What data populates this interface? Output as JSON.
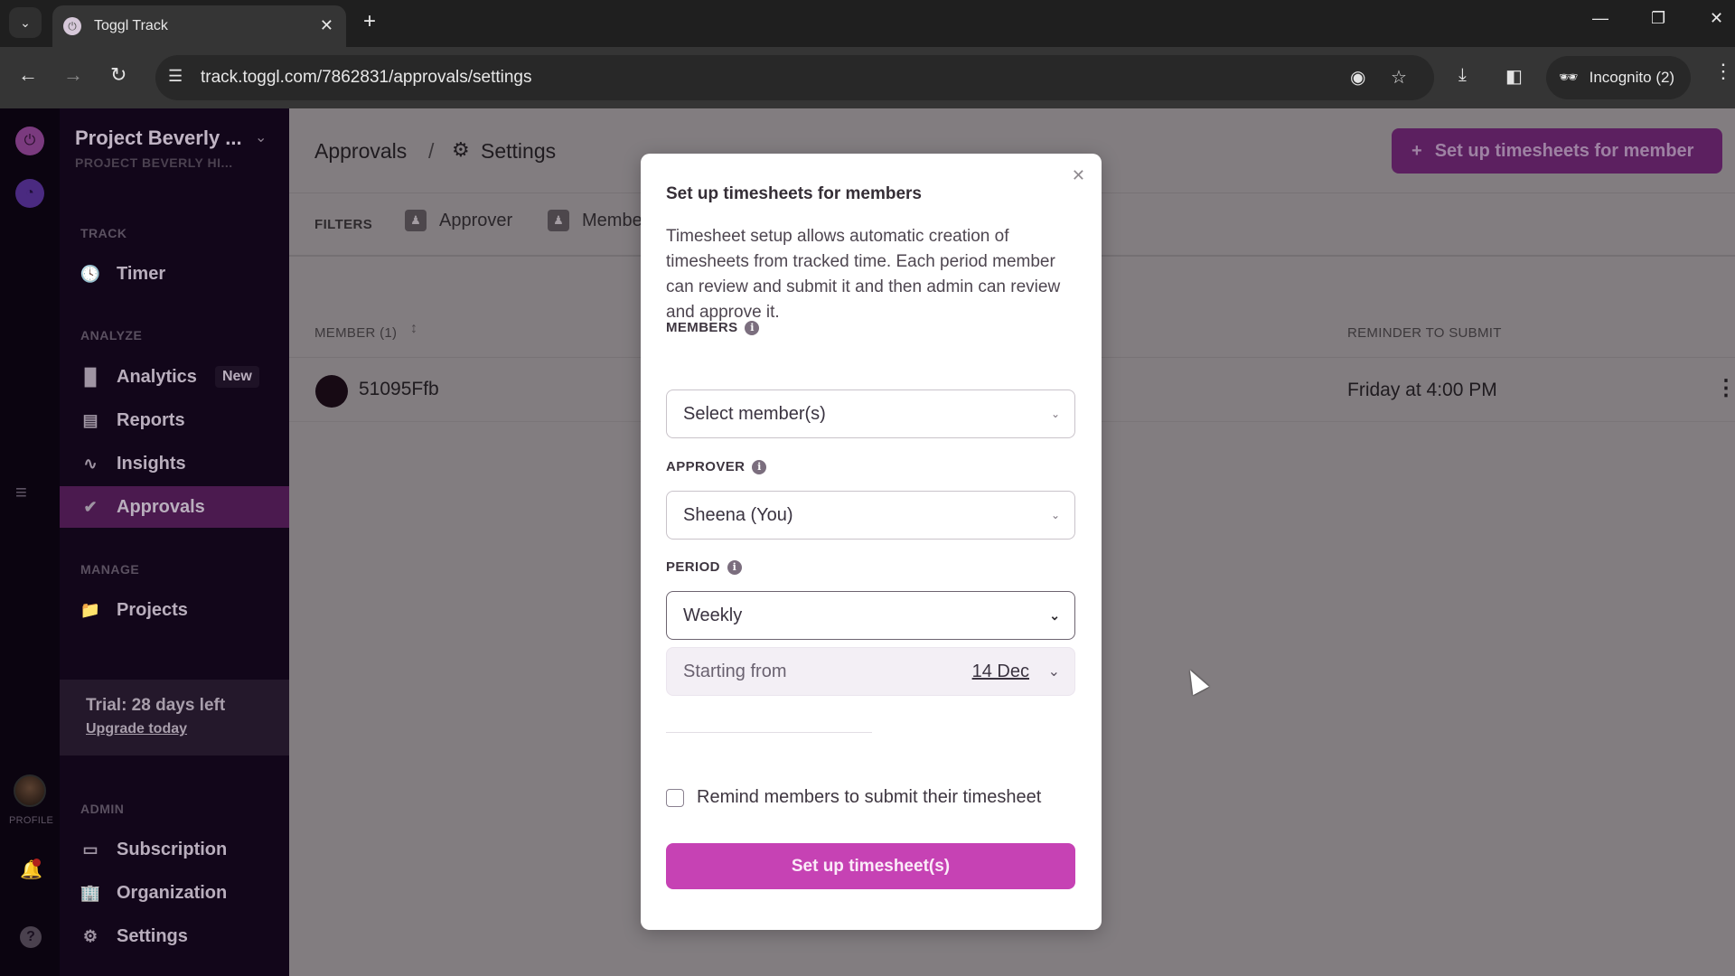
{
  "browser": {
    "tab_title": "Toggl Track",
    "url": "track.toggl.com/7862831/approvals/settings",
    "incognito_label": "Incognito (2)"
  },
  "sidebar": {
    "workspace_name": "Project Beverly ...",
    "workspace_sub": "PROJECT BEVERLY HI...",
    "sections": {
      "track": "TRACK",
      "analyze": "ANALYZE",
      "manage": "MANAGE",
      "admin": "ADMIN"
    },
    "items": {
      "timer": "Timer",
      "analytics": "Analytics",
      "analytics_badge": "New",
      "reports": "Reports",
      "insights": "Insights",
      "approvals": "Approvals",
      "projects": "Projects",
      "subscription": "Subscription",
      "organization": "Organization",
      "settings": "Settings"
    },
    "trial_text": "Trial: 28 days left",
    "upgrade_link": "Upgrade today",
    "profile_label": "PROFILE",
    "active_item": "Approvals"
  },
  "header": {
    "breadcrumb_parent": "Approvals",
    "breadcrumb_separator": "/",
    "breadcrumb_current": "Settings",
    "setup_member_button": "Set up timesheets for member"
  },
  "filters": {
    "label": "FILTERS",
    "chips": [
      "Approver",
      "Membe"
    ]
  },
  "table": {
    "columns": {
      "member": "MEMBER (1)",
      "reminder": "REMINDER TO SUBMIT"
    },
    "rows": [
      {
        "member": "51095Ffb",
        "reminder": "Friday at 4:00 PM"
      }
    ]
  },
  "modal": {
    "title": "Set up timesheets for members",
    "description": "Timesheet setup allows automatic creation of timesheets from tracked time. Each period member can review and submit it and then admin can review and approve it.",
    "members_label": "MEMBERS",
    "members_placeholder": "Select member(s)",
    "approver_label": "APPROVER",
    "approver_value": "Sheena (You)",
    "period_label": "PERIOD",
    "period_value": "Weekly",
    "starting_label": "Starting from",
    "starting_date": "14 Dec",
    "remind_label": "Remind members to submit their timesheet",
    "remind_checked": false,
    "submit_button": "Set up timesheet(s)"
  },
  "colors": {
    "brand_primary": "#c642b4",
    "sidebar_bg": "#12061a",
    "sidebar_active": "#4b1a4f",
    "overlay_main": "#827d80"
  }
}
